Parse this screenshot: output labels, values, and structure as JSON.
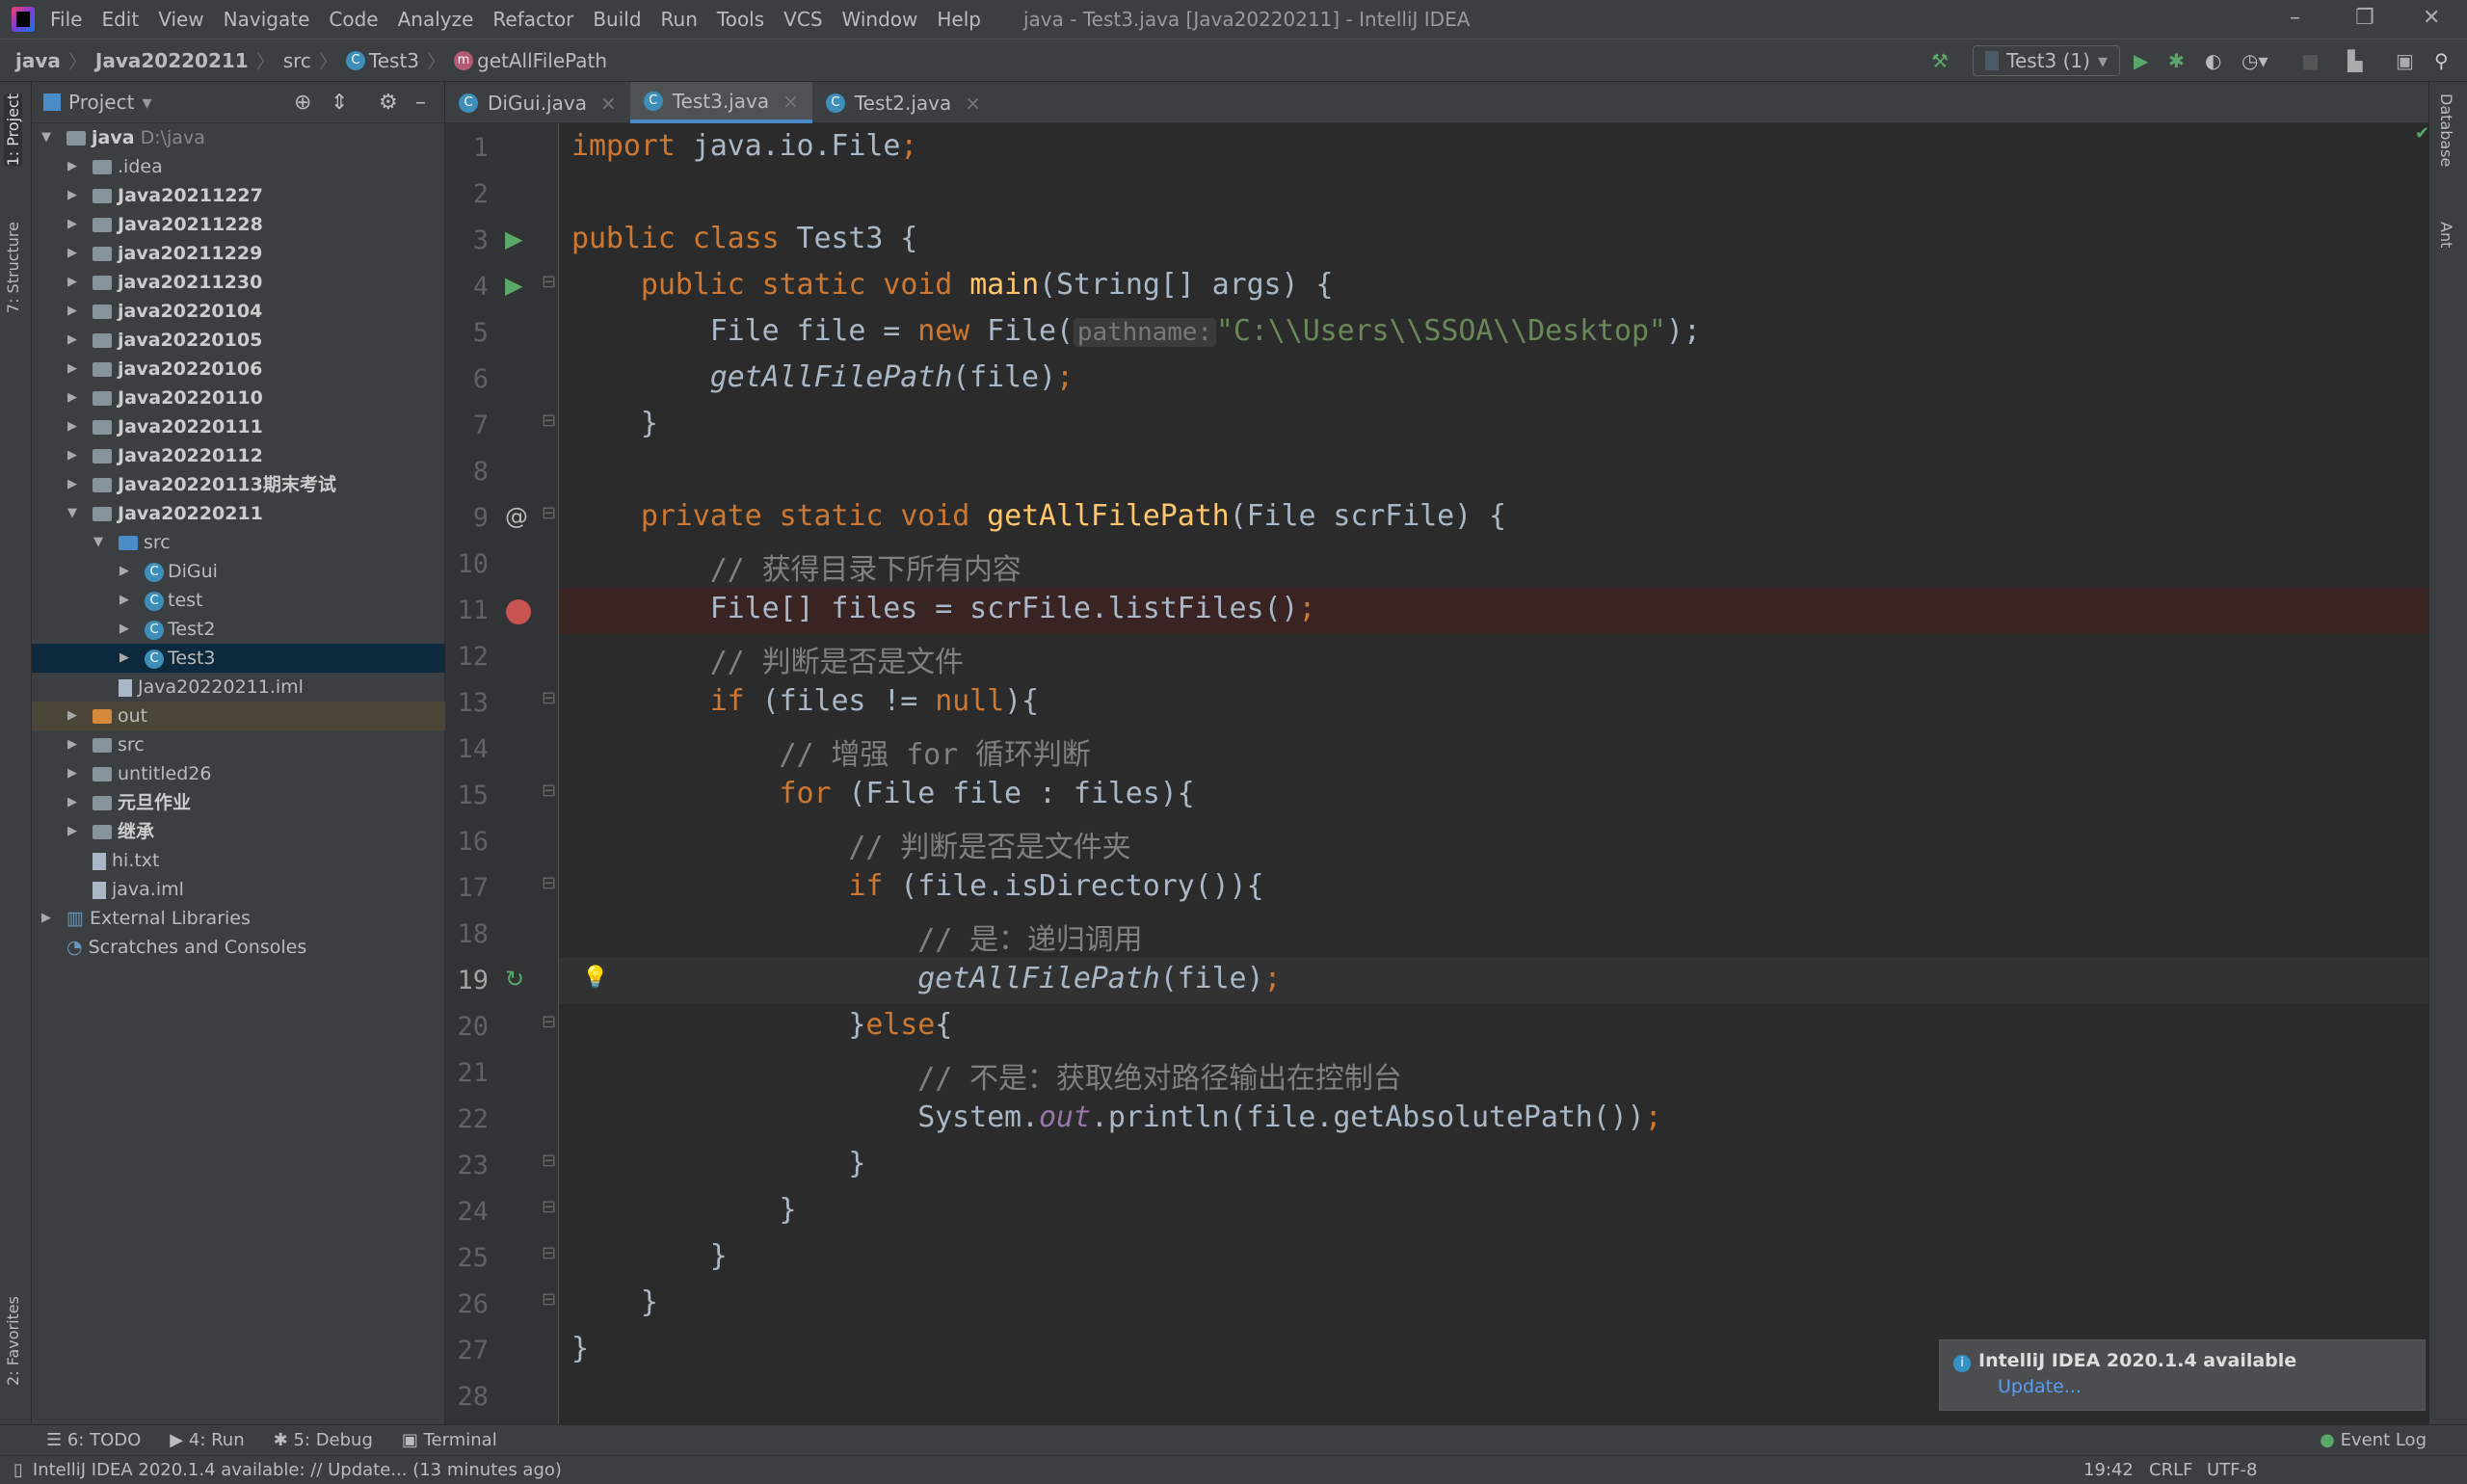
{
  "window": {
    "title": "java - Test3.java [Java20220211] - IntelliJ IDEA"
  },
  "menu": [
    "File",
    "Edit",
    "View",
    "Navigate",
    "Code",
    "Analyze",
    "Refactor",
    "Build",
    "Run",
    "Tools",
    "VCS",
    "Window",
    "Help"
  ],
  "breadcrumb": [
    "java",
    "Java20220211",
    "src",
    "Test3",
    "getAllFilePath"
  ],
  "toolbar": {
    "run_config": "Test3 (1)"
  },
  "left_strip": {
    "project_tab": "1: Project",
    "structure_tab": "7: Structure",
    "favorites_tab": "2: Favorites"
  },
  "right_strip": {
    "database_tab": "Database",
    "ant_tab": "Ant"
  },
  "project_panel": {
    "title": "Project",
    "tree": [
      {
        "label": "java",
        "hint": "D:\\java",
        "depth": 0,
        "kind": "module",
        "expanded": true
      },
      {
        "label": ".idea",
        "depth": 1,
        "kind": "folder"
      },
      {
        "label": "Java20211227",
        "depth": 1,
        "kind": "module"
      },
      {
        "label": "Java20211228",
        "depth": 1,
        "kind": "module"
      },
      {
        "label": "java20211229",
        "depth": 1,
        "kind": "module"
      },
      {
        "label": "java20211230",
        "depth": 1,
        "kind": "module"
      },
      {
        "label": "java20220104",
        "depth": 1,
        "kind": "module"
      },
      {
        "label": "java20220105",
        "depth": 1,
        "kind": "module"
      },
      {
        "label": "java20220106",
        "depth": 1,
        "kind": "module"
      },
      {
        "label": "Java20220110",
        "depth": 1,
        "kind": "module"
      },
      {
        "label": "Java20220111",
        "depth": 1,
        "kind": "module"
      },
      {
        "label": "Java20220112",
        "depth": 1,
        "kind": "module"
      },
      {
        "label": "Java20220113期末考试",
        "depth": 1,
        "kind": "module"
      },
      {
        "label": "Java20220211",
        "depth": 1,
        "kind": "module",
        "expanded": true
      },
      {
        "label": "src",
        "depth": 2,
        "kind": "src",
        "expanded": true
      },
      {
        "label": "DiGui",
        "depth": 3,
        "kind": "class"
      },
      {
        "label": "test",
        "depth": 3,
        "kind": "class"
      },
      {
        "label": "Test2",
        "depth": 3,
        "kind": "class"
      },
      {
        "label": "Test3",
        "depth": 3,
        "kind": "class",
        "selected": true
      },
      {
        "label": "Java20220211.iml",
        "depth": 2,
        "kind": "file"
      },
      {
        "label": "out",
        "depth": 1,
        "kind": "out"
      },
      {
        "label": "src",
        "depth": 1,
        "kind": "folder"
      },
      {
        "label": "untitled26",
        "depth": 1,
        "kind": "folder"
      },
      {
        "label": "元旦作业",
        "depth": 1,
        "kind": "module"
      },
      {
        "label": "继承",
        "depth": 1,
        "kind": "module"
      },
      {
        "label": "hi.txt",
        "depth": 1,
        "kind": "file",
        "leaf": true
      },
      {
        "label": "java.iml",
        "depth": 1,
        "kind": "file",
        "leaf": true
      },
      {
        "label": "External Libraries",
        "depth": 0,
        "kind": "lib"
      },
      {
        "label": "Scratches and Consoles",
        "depth": 0,
        "kind": "scratch",
        "leaf": true
      }
    ]
  },
  "tabs": [
    {
      "label": "DiGui.java"
    },
    {
      "label": "Test3.java",
      "active": true
    },
    {
      "label": "Test2.java"
    }
  ],
  "editor": {
    "breakpoint_line": 11,
    "current_line": 19,
    "hint_pathname": "pathname:",
    "lines": [
      "import java.io.File;",
      "",
      "public class Test3 {",
      "    public static void main(String[] args) {",
      "        File file = new File(",
      "        getAllFilePath(file);",
      "    }",
      "",
      "    private static void getAllFilePath(File scrFile) {",
      "        // 获得目录下所有内容",
      "        File[] files = scrFile.listFiles();",
      "        // 判断是否是文件",
      "        if (files != null){",
      "            // 增强 for 循环判断",
      "            for (File file : files){",
      "                // 判断是否是文件夹",
      "                if (file.isDirectory()){",
      "                    // 是：递归调用",
      "                    getAllFilePath(file);",
      "                }else{",
      "                    // 不是：获取绝对路径输出在控制台",
      "                    System.out.println(file.getAbsolutePath());",
      "                }",
      "            }",
      "        }",
      "    }",
      "}",
      ""
    ],
    "string_literal": "\"C:\\\\Users\\\\SSOA\\\\Desktop\""
  },
  "notification": {
    "title": "IntelliJ IDEA 2020.1.4 available",
    "link": "Update..."
  },
  "bottom_tools": [
    "6: TODO",
    "4: Run",
    "5: Debug",
    "Terminal"
  ],
  "event_log": "Event Log",
  "status": {
    "message": "IntelliJ IDEA 2020.1.4 available: // Update... (13 minutes ago)",
    "position": "19:42",
    "line_sep": "CRLF",
    "encoding": "UTF-8"
  }
}
